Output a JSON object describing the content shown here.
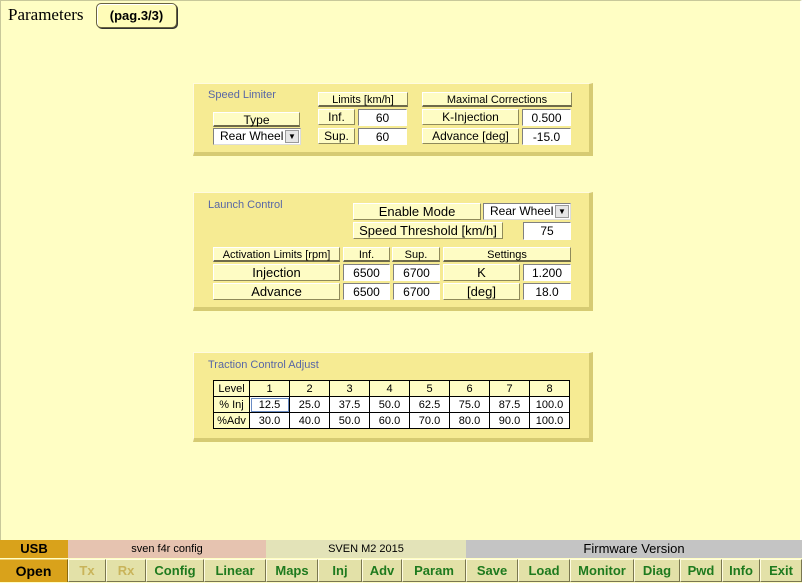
{
  "header": {
    "title": "Parameters",
    "page_button": "(pag.3/3)"
  },
  "speed_limiter": {
    "title": "Speed Limiter",
    "type_label": "Type",
    "type_value": "Rear Wheel",
    "limits_header": "Limits [km/h]",
    "inf_label": "Inf.",
    "inf_value": "60",
    "sup_label": "Sup.",
    "sup_value": "60",
    "corrections_header": "Maximal Corrections",
    "k_injection_label": "K-Injection",
    "k_injection_value": "0.500",
    "advance_label": "Advance [deg]",
    "advance_value": "-15.0"
  },
  "launch_control": {
    "title": "Launch Control",
    "enable_mode_label": "Enable Mode",
    "enable_mode_value": "Rear Wheel",
    "speed_threshold_label": "Speed Threshold [km/h]",
    "speed_threshold_value": "75",
    "activation_header": "Activation Limits [rpm]",
    "inf_header": "Inf.",
    "sup_header": "Sup.",
    "settings_header": "Settings",
    "injection_label": "Injection",
    "injection_inf": "6500",
    "injection_sup": "6700",
    "k_label": "K",
    "k_value": "1.200",
    "advance_label": "Advance",
    "advance_inf": "6500",
    "advance_sup": "6700",
    "deg_label": "[deg]",
    "deg_value": "18.0"
  },
  "traction_control": {
    "title": "Traction Control Adjust",
    "level_label": "Level",
    "levels": [
      "1",
      "2",
      "3",
      "4",
      "5",
      "6",
      "7",
      "8"
    ],
    "inj_label": "% Inj",
    "inj_values": [
      "12.5",
      "25.0",
      "37.5",
      "50.0",
      "62.5",
      "75.0",
      "87.5",
      "100.0"
    ],
    "adv_label": "%Adv",
    "adv_values": [
      "30.0",
      "40.0",
      "50.0",
      "60.0",
      "70.0",
      "80.0",
      "90.0",
      "100.0"
    ]
  },
  "status_bar": {
    "usb": "USB",
    "config_name": "sven f4r config",
    "map_name": "SVEN M2 2015",
    "firmware": "Firmware Version",
    "buttons": {
      "open": "Open",
      "tx": "Tx",
      "rx": "Rx",
      "config": "Config",
      "linear": "Linear",
      "maps": "Maps",
      "inj": "Inj",
      "adv": "Adv",
      "param": "Param",
      "save": "Save",
      "load": "Load",
      "monitor": "Monitor",
      "diag": "Diag",
      "pwd": "Pwd",
      "info": "Info",
      "exit": "Exit"
    }
  },
  "colors": {
    "background": "#fffec4",
    "panel": "#f6eb93",
    "panel_title": "#5866a6",
    "button_text": "#1e7a1e",
    "usb_bg": "#d9a21b"
  }
}
